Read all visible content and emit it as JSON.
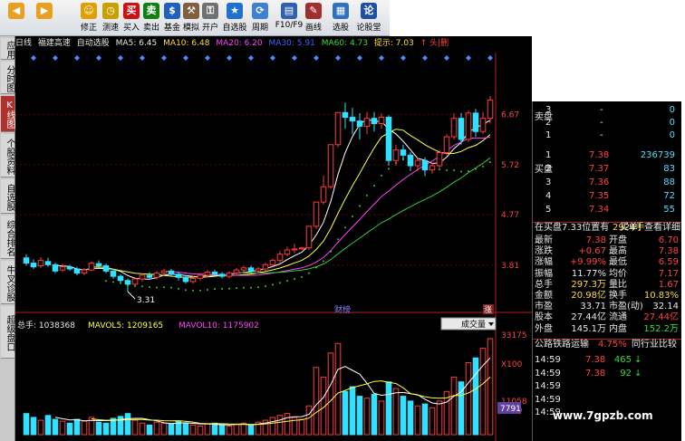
{
  "toolbar": {
    "buttons": [
      {
        "label": "",
        "icon": "back-icon",
        "color": "#e8a020"
      },
      {
        "label": "",
        "icon": "forward-icon",
        "color": "#e8a020"
      },
      {
        "label": "修正",
        "icon": "smiley-icon",
        "color": "#e0a000"
      },
      {
        "label": "测速",
        "icon": "clock-icon",
        "color": "#c8a000"
      },
      {
        "label": "买入",
        "icon": "buy-icon",
        "color": "#d01010",
        "glyph": "买"
      },
      {
        "label": "卖出",
        "icon": "sell-icon",
        "color": "#108010",
        "glyph": "卖"
      },
      {
        "label": "基金",
        "icon": "fund-icon",
        "color": "#2060c0"
      },
      {
        "label": "模拟",
        "icon": "hammer-icon",
        "color": "#806040"
      },
      {
        "label": "开户",
        "icon": "lock-icon",
        "color": "#707070"
      },
      {
        "label": "自选股",
        "icon": "star-icon",
        "color": "#2070d0"
      },
      {
        "label": "周期",
        "icon": "cycle-icon",
        "color": "#4080d0"
      },
      {
        "label": "F10/F9",
        "icon": "doc-icon",
        "color": "#3060b0"
      },
      {
        "label": "画线",
        "icon": "pen-icon",
        "color": "#a03030"
      },
      {
        "label": "选股",
        "icon": "chart-icon",
        "color": "#3070c0"
      },
      {
        "label": "论股堂",
        "icon": "forum-icon",
        "color": "#2050a0",
        "glyph": "论"
      }
    ]
  },
  "side_tabs": [
    "应用",
    "分时图",
    "K线图",
    "个股资料",
    "自选股",
    "综合排名",
    "牛叉诊股",
    "超级盘口"
  ],
  "active_tab_index": 2,
  "ma_bar": {
    "period": "日线",
    "name": "福建高速",
    "button": "自动选股",
    "ma5": "MA5: 6.45",
    "ma10": "MA10: 6.48",
    "ma20": "MA20: 6.20",
    "ma30": "MA30: 5.91",
    "ma60": "MA60: 4.73",
    "hint": "提示: 7.03",
    "extra": "↑ 头|删"
  },
  "price_axis": [
    "6.67",
    "5.72",
    "4.77",
    "3.81"
  ],
  "low_label": "3.31",
  "event_labels": {
    "finance": "财榜",
    "up": "涨"
  },
  "volume": {
    "total": "总手: 1038368",
    "mavol5": "MAVOL5: 1209165",
    "mavol10": "MAVOL10: 1175902",
    "selector": "成交量",
    "axis": [
      "33175",
      "X100",
      "11058",
      "X100"
    ],
    "badge": "7791"
  },
  "chart_data": {
    "type": "candlestick",
    "ylim": [
      3.0,
      7.3
    ],
    "candles": [
      [
        3.95,
        3.85,
        4.02,
        3.8
      ],
      [
        3.85,
        3.78,
        3.92,
        3.74
      ],
      [
        3.8,
        3.9,
        3.96,
        3.76
      ],
      [
        3.88,
        3.82,
        3.95,
        3.78
      ],
      [
        3.82,
        3.7,
        3.86,
        3.66
      ],
      [
        3.72,
        3.78,
        3.84,
        3.68
      ],
      [
        3.78,
        3.74,
        3.82,
        3.7
      ],
      [
        3.74,
        3.66,
        3.78,
        3.62
      ],
      [
        3.66,
        3.72,
        3.76,
        3.62
      ],
      [
        3.72,
        3.85,
        3.88,
        3.7
      ],
      [
        3.84,
        3.8,
        3.9,
        3.76
      ],
      [
        3.8,
        3.7,
        3.84,
        3.66
      ],
      [
        3.7,
        3.6,
        3.74,
        3.55
      ],
      [
        3.6,
        3.52,
        3.64,
        3.48
      ],
      [
        3.52,
        3.45,
        3.56,
        3.31
      ],
      [
        3.45,
        3.55,
        3.58,
        3.42
      ],
      [
        3.55,
        3.62,
        3.66,
        3.5
      ],
      [
        3.62,
        3.58,
        3.68,
        3.54
      ],
      [
        3.58,
        3.66,
        3.7,
        3.54
      ],
      [
        3.66,
        3.7,
        3.74,
        3.62
      ],
      [
        3.7,
        3.64,
        3.74,
        3.6
      ],
      [
        3.64,
        3.58,
        3.68,
        3.52
      ],
      [
        3.58,
        3.5,
        3.62,
        3.46
      ],
      [
        3.5,
        3.56,
        3.6,
        3.46
      ],
      [
        3.56,
        3.62,
        3.66,
        3.52
      ],
      [
        3.62,
        3.68,
        3.72,
        3.58
      ],
      [
        3.68,
        3.64,
        3.72,
        3.6
      ],
      [
        3.64,
        3.6,
        3.68,
        3.56
      ],
      [
        3.6,
        3.66,
        3.7,
        3.56
      ],
      [
        3.66,
        3.72,
        3.76,
        3.62
      ],
      [
        3.72,
        3.76,
        3.8,
        3.68
      ],
      [
        3.76,
        3.7,
        3.8,
        3.66
      ],
      [
        3.7,
        3.74,
        3.78,
        3.66
      ],
      [
        3.74,
        3.82,
        3.86,
        3.7
      ],
      [
        3.82,
        3.9,
        3.94,
        3.78
      ],
      [
        3.9,
        4.02,
        4.08,
        3.86
      ],
      [
        4.02,
        4.1,
        4.16,
        3.98
      ],
      [
        4.1,
        4.12,
        4.22,
        4.04
      ],
      [
        4.12,
        4.14,
        4.16,
        4.1
      ],
      [
        4.14,
        4.55,
        4.55,
        4.1
      ],
      [
        4.55,
        5.01,
        5.01,
        4.5
      ],
      [
        5.01,
        5.3,
        5.51,
        4.96
      ],
      [
        5.3,
        6.1,
        6.1,
        5.26
      ],
      [
        6.1,
        6.71,
        6.71,
        6.05
      ],
      [
        6.71,
        6.62,
        6.9,
        6.4
      ],
      [
        6.62,
        6.55,
        6.8,
        6.3
      ],
      [
        6.55,
        6.45,
        6.7,
        6.2
      ],
      [
        6.45,
        6.6,
        6.72,
        6.3
      ],
      [
        6.6,
        6.5,
        6.72,
        6.35
      ],
      [
        6.5,
        6.62,
        6.7,
        6.4
      ],
      [
        6.62,
        5.8,
        6.66,
        5.7
      ],
      [
        5.8,
        6.0,
        6.1,
        5.7
      ],
      [
        6.0,
        5.9,
        6.1,
        5.8
      ],
      [
        5.9,
        5.7,
        5.96,
        5.6
      ],
      [
        5.7,
        5.8,
        5.86,
        5.6
      ],
      [
        5.8,
        5.62,
        5.86,
        5.5
      ],
      [
        5.62,
        5.7,
        5.76,
        5.55
      ],
      [
        5.7,
        5.95,
        6.0,
        5.66
      ],
      [
        5.95,
        6.25,
        6.3,
        5.9
      ],
      [
        6.25,
        6.6,
        6.7,
        6.2
      ],
      [
        6.6,
        6.2,
        6.7,
        6.1
      ],
      [
        6.2,
        6.7,
        6.75,
        6.15
      ],
      [
        6.7,
        6.35,
        6.78,
        6.25
      ],
      [
        6.35,
        6.6,
        6.72,
        6.3
      ],
      [
        6.6,
        6.95,
        7.03,
        6.5
      ]
    ],
    "volumes": [
      22,
      18,
      15,
      20,
      16,
      14,
      12,
      16,
      14,
      18,
      13,
      12,
      17,
      19,
      22,
      15,
      12,
      10,
      13,
      12,
      11,
      14,
      12,
      10,
      9,
      11,
      12,
      10,
      9,
      11,
      12,
      10,
      13,
      15,
      18,
      20,
      22,
      18,
      16,
      30,
      70,
      60,
      85,
      95,
      45,
      50,
      40,
      38,
      42,
      35,
      55,
      48,
      40,
      35,
      30,
      32,
      28,
      35,
      45,
      60,
      55,
      75,
      80,
      90,
      100
    ]
  },
  "order_book": {
    "sells": [
      {
        "level": "3",
        "price": "-",
        "vol": "0"
      },
      {
        "level": "2",
        "price": "-",
        "vol": "0"
      },
      {
        "level": "1",
        "price": "-",
        "vol": "0"
      }
    ],
    "buys": [
      {
        "level": "1",
        "price": "7.38",
        "vol": "236739"
      },
      {
        "level": "2",
        "price": "7.37",
        "vol": "83"
      },
      {
        "level": "3",
        "price": "7.36",
        "vol": "88"
      },
      {
        "level": "4",
        "price": "7.35",
        "vol": "72"
      },
      {
        "level": "5",
        "price": "7.34",
        "vol": "55"
      }
    ],
    "sell_side_label": "卖盘",
    "buy_side_label": "买盘"
  },
  "status_line": {
    "left": "在买盘7.33位置有",
    "mid": "2924手",
    "right": "买单! 查看详细"
  },
  "quote": [
    {
      "l1": "最新",
      "v1": "7.38",
      "l2": "开盘",
      "v2": "6.70"
    },
    {
      "l1": "涨跌",
      "v1": "+0.67",
      "l2": "最高",
      "v2": "7.38"
    },
    {
      "l1": "涨幅",
      "v1": "+9.99%",
      "l2": "最低",
      "v2": "6.59"
    },
    {
      "l1": "振幅",
      "v1": "11.77%",
      "l2": "均价",
      "v2": "7.17"
    },
    {
      "l1": "总手",
      "v1": "297.3万",
      "l2": "量比",
      "v2": "1.67"
    },
    {
      "l1": "金额",
      "v1": "20.98亿",
      "l2": "换手",
      "v2": "10.83%"
    },
    {
      "l1": "市盈",
      "v1": "33.71",
      "l2": "市盈(动)",
      "v2": "32.14"
    },
    {
      "l1": "股本",
      "v1": "27.44亿",
      "l2": "流通",
      "v2": "27.44亿"
    },
    {
      "l1": "外盘",
      "v1": "145.1万",
      "l2": "内盘",
      "v2": "152.2万"
    }
  ],
  "industry": {
    "name": "公路铁路运输",
    "pct": "4.75%",
    "button": "同行业比较"
  },
  "ticks": [
    {
      "time": "14:59",
      "price": "7.38",
      "vol": "465",
      "dir": "down"
    },
    {
      "time": "14:59",
      "price": "7.38",
      "vol": "92",
      "dir": "down"
    },
    {
      "time": "14:59",
      "price": "",
      "vol": "",
      "dir": ""
    },
    {
      "time": "14:59",
      "price": "",
      "vol": "",
      "dir": ""
    },
    {
      "time": "14:59",
      "price": "",
      "vol": "",
      "dir": ""
    }
  ],
  "watermark": "www.7gpzb.com",
  "colors": {
    "up": "#ff3c3c",
    "down": "#33e0ff",
    "ma5": "#ffffff",
    "ma10": "#ffff44",
    "ma20": "#ff44ff",
    "ma30": "#33cc33",
    "ma60": "#4060ff"
  }
}
